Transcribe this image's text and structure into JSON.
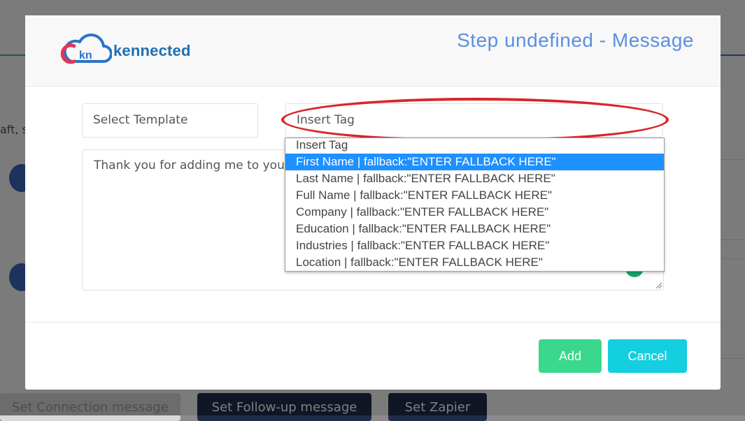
{
  "background": {
    "side_text": "aft, s",
    "buttons": {
      "connection": "Set Connection message",
      "followup": "Set Follow-up message",
      "zapier": "Set Zapier"
    }
  },
  "modal": {
    "logo_text": "kennected",
    "logo_badge": "kn",
    "title": "Step undefined - Message",
    "select_template_label": "Select Template",
    "insert_tag_label": "Insert Tag",
    "message_text": "Thank you for adding me to your",
    "dropdown": {
      "options": [
        "Insert Tag",
        "First Name | fallback:\"ENTER FALLBACK HERE\"",
        "Last Name | fallback:\"ENTER FALLBACK HERE\"",
        "Full Name | fallback:\"ENTER FALLBACK HERE\"",
        "Company | fallback:\"ENTER FALLBACK HERE\"",
        "Education | fallback:\"ENTER FALLBACK HERE\"",
        "Industries | fallback:\"ENTER FALLBACK HERE\"",
        "Location | fallback:\"ENTER FALLBACK HERE\""
      ],
      "selected": "First Name | fallback:\"ENTER FALLBACK HERE\""
    },
    "add_label": "Add",
    "cancel_label": "Cancel"
  },
  "colors": {
    "title": "#5b8fe0",
    "add": "#3ad88c",
    "cancel": "#13cfe0",
    "selected": "#1e90ff",
    "highlight": "#d8252b"
  }
}
